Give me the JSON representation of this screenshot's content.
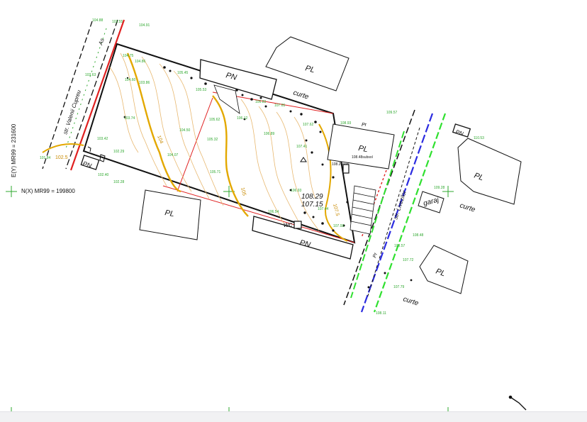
{
  "labels": {
    "pl": "PL",
    "pn": "PN",
    "curte": "curte",
    "garaj": "garaj",
    "wc": "wc",
    "pr": "Pr",
    "as": "As"
  },
  "streets": {
    "left": "str. Valenii Cupreu",
    "right": "str. Livezilor"
  },
  "coordinates": {
    "y": "E(Y) MR99 = 231600",
    "x": "N(X) MR99 = 199800"
  },
  "elevations": {
    "top": "108.29",
    "bottom": "107.15"
  },
  "contours": [
    "104",
    "102.5",
    "107.5",
    "105"
  ],
  "spot_heights": [
    "104.91",
    "104.88",
    "104.75",
    "103.63",
    "102.55",
    "104.86",
    "105.45",
    "105.53",
    "104.60",
    "103.74",
    "102.29",
    "102.40",
    "102.28",
    "103.42",
    "104.07",
    "104.50",
    "105.32",
    "105.62",
    "105.71",
    "106.12",
    "106.83",
    "106.89",
    "107.41",
    "107.62",
    "107.65",
    "108.93",
    "109.57",
    "110.53",
    "109.28",
    "108.48",
    "108.57",
    "107.72",
    "107.79",
    "106.54",
    "106.93",
    "107.44",
    "103.86",
    "101.84",
    "108.11",
    "107.93"
  ],
  "building_notes": {
    "upper": "108.48subsol",
    "lower": "108.25pod"
  },
  "markers": [
    "PN",
    "PN"
  ]
}
